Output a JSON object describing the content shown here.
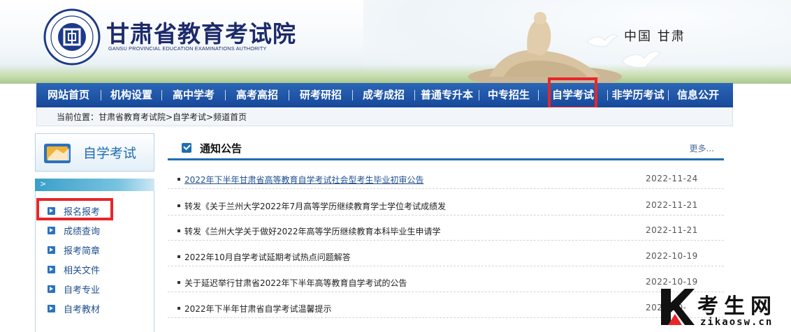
{
  "header": {
    "title": "甘肃省教育考试院",
    "subtitle": "GANSU PROVINCIAL EDUCATION EXAMINATIONS AUTHORITY",
    "region": "中国 甘肃"
  },
  "nav": {
    "items": [
      {
        "label": "网站首页"
      },
      {
        "label": "机构设置"
      },
      {
        "label": "高中学考"
      },
      {
        "label": "高考高招"
      },
      {
        "label": "研考研招"
      },
      {
        "label": "成考成招"
      },
      {
        "label": "普通专升本"
      },
      {
        "label": "中专招生"
      },
      {
        "label": "自学考试",
        "highlighted": true
      },
      {
        "label": "非学历考试"
      },
      {
        "label": "信息公开"
      }
    ]
  },
  "breadcrumb": {
    "text": "当前位置：甘肃省教育考试院>自学考试>频道首页"
  },
  "sidebar": {
    "title": "自学考试",
    "tab_marker": ">",
    "items": [
      {
        "label": "报名报考",
        "highlighted": true
      },
      {
        "label": "成绩查询"
      },
      {
        "label": "报考简章"
      },
      {
        "label": "相关文件"
      },
      {
        "label": "自考专业"
      },
      {
        "label": "自考教材"
      }
    ]
  },
  "notices": {
    "title": "通知公告",
    "more": "更多...",
    "items": [
      {
        "title": "2022年下半年甘肃省高等教育自学考试社会型考生毕业初审公告",
        "date": "2022-11-24",
        "link": true
      },
      {
        "title": "转发《关于兰州大学2022年7月高等学历继续教育学士学位考试成绩发",
        "date": "2022-11-21"
      },
      {
        "title": "转发《兰州大学关于做好2022年高等学历继续教育本科毕业生申请学",
        "date": "2022-11-21"
      },
      {
        "title": "2022年10月自学考试延期考试热点问题解答",
        "date": "2022-10-19"
      },
      {
        "title": "关于延迟举行甘肃省2022年下半年高等教育自学考试的公告",
        "date": "2022-10-19"
      },
      {
        "title": "2022年下半年甘肃省自学考试温馨提示",
        "date": "2022-10-"
      }
    ]
  },
  "watermark": {
    "text": "考生网",
    "url": "zikaosw.cn"
  },
  "colors": {
    "nav_blue": "#1f5aa8",
    "highlight_red": "#e8262a",
    "link_blue": "#1f4f8f"
  }
}
